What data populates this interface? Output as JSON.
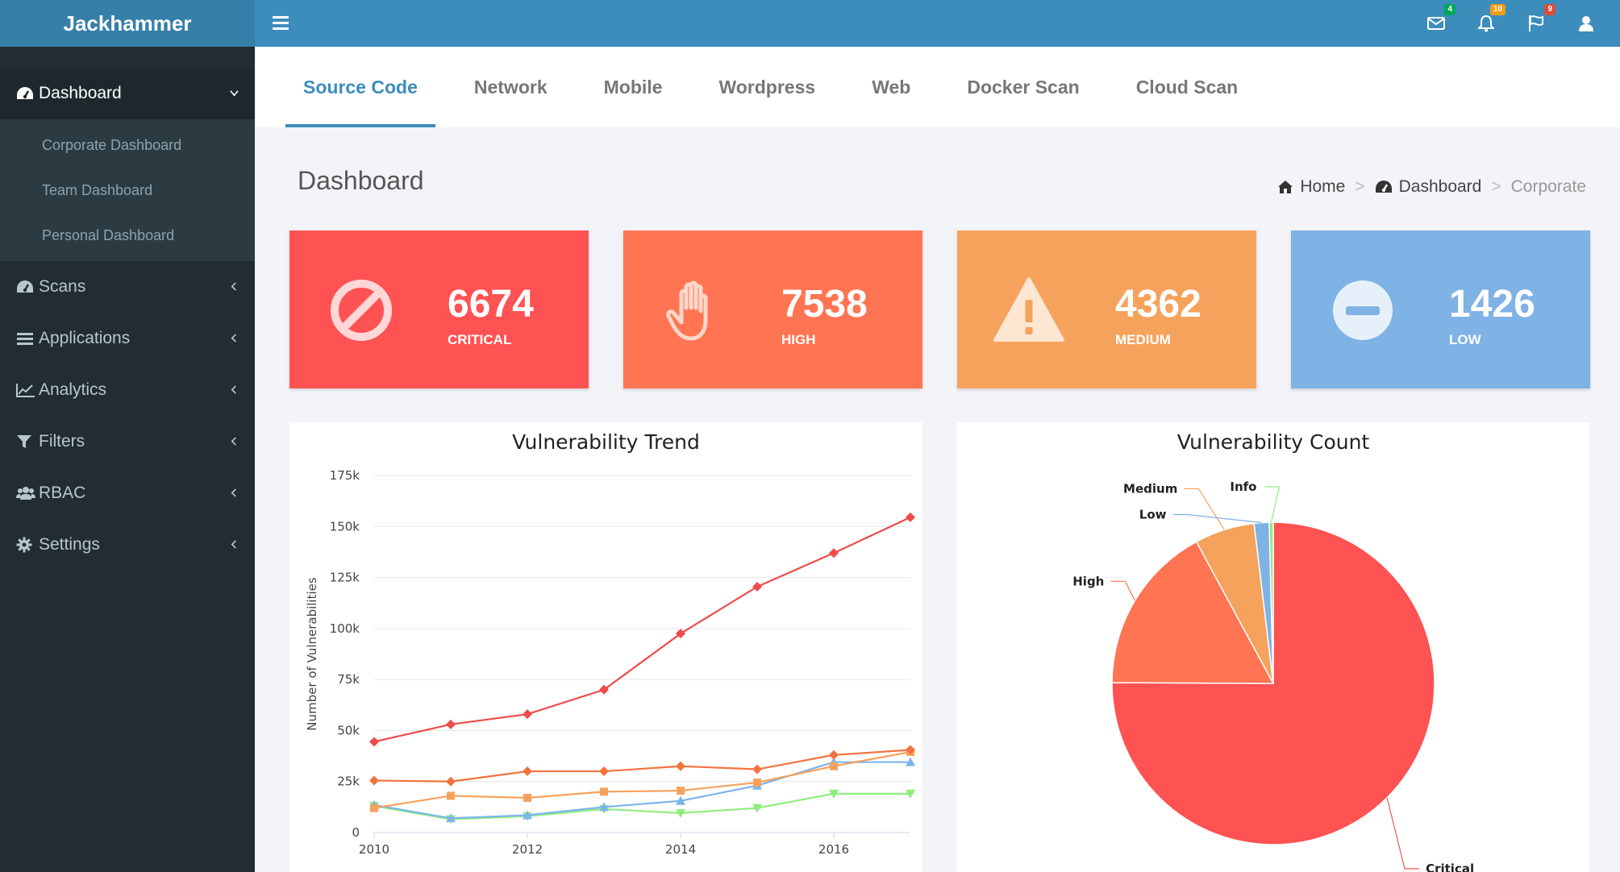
{
  "app": {
    "title": "Jackhammer"
  },
  "topbar": {
    "icons": [
      {
        "icon": "envelope-icon",
        "badge": "4",
        "badge_color": "#00a65a"
      },
      {
        "icon": "bell-icon",
        "badge": "10",
        "badge_color": "#f39c12"
      },
      {
        "icon": "flag-icon",
        "badge": "9",
        "badge_color": "#dd4b39"
      },
      {
        "icon": "user-icon"
      }
    ]
  },
  "sidebar": {
    "active": {
      "label": "Dashboard",
      "icon": "dashboard-icon"
    },
    "submenu": [
      "Corporate Dashboard",
      "Team Dashboard",
      "Personal Dashboard"
    ],
    "items": [
      {
        "label": "Scans",
        "icon": "dashboard-icon"
      },
      {
        "label": "Applications",
        "icon": "list-icon"
      },
      {
        "label": "Analytics",
        "icon": "line-chart-icon"
      },
      {
        "label": "Filters",
        "icon": "filter-icon"
      },
      {
        "label": "RBAC",
        "icon": "users-icon"
      },
      {
        "label": "Settings",
        "icon": "gear-icon"
      }
    ]
  },
  "tabs": [
    "Source Code",
    "Network",
    "Mobile",
    "Wordpress",
    "Web",
    "Docker Scan",
    "Cloud Scan"
  ],
  "header": {
    "title": "Dashboard"
  },
  "breadcrumb": {
    "home": "Home",
    "dashboard": "Dashboard",
    "current": "Corporate",
    "separator": ">"
  },
  "stats": [
    {
      "value": "6674",
      "label": "CRITICAL",
      "color": "#ff5252",
      "icon": "ban-icon"
    },
    {
      "value": "7538",
      "label": "HIGH",
      "color": "#ff7452",
      "icon": "hand-icon"
    },
    {
      "value": "4362",
      "label": "MEDIUM",
      "color": "#f5a25d",
      "icon": "warning-icon"
    },
    {
      "value": "1426",
      "label": "LOW",
      "color": "#7fb2e5",
      "icon": "minus-circle-icon"
    }
  ],
  "chart_data": [
    {
      "type": "line",
      "title": "Vulnerability Trend",
      "ylabel": "Number of Vulnerabilities",
      "xlabel": "",
      "x": [
        2010,
        2011,
        2012,
        2013,
        2014,
        2015,
        2016,
        2017
      ],
      "xticks": [
        "2010",
        "2012",
        "2014",
        "2016"
      ],
      "yticks": [
        "0",
        "25k",
        "50k",
        "75k",
        "100k",
        "125k",
        "150k",
        "175k"
      ],
      "ylim": [
        0,
        175000
      ],
      "xlim": [
        2010,
        2017
      ],
      "grid": true,
      "series": [
        {
          "color": "#ef4b4b",
          "marker": "diamond",
          "values": [
            44500,
            53000,
            58000,
            70000,
            97500,
            120500,
            137000,
            154500
          ]
        },
        {
          "color": "#f3733f",
          "marker": "diamond",
          "values": [
            25500,
            25000,
            30000,
            30000,
            32500,
            31000,
            38000,
            40500
          ]
        },
        {
          "color": "#f5a25d",
          "marker": "square",
          "values": [
            12000,
            18000,
            17000,
            20000,
            20500,
            24500,
            32500,
            39500
          ]
        },
        {
          "color": "#7cb5ec",
          "marker": "triangle",
          "values": [
            13500,
            7000,
            8500,
            12500,
            15500,
            23000,
            34500,
            34500
          ]
        },
        {
          "color": "#90ed7d",
          "marker": "triangle-down",
          "values": [
            13000,
            6500,
            8000,
            11500,
            9500,
            12000,
            19000,
            19000
          ]
        }
      ]
    },
    {
      "type": "pie",
      "title": "Vulnerability Count",
      "slices": [
        {
          "label": "Critical",
          "value": 75,
          "color": "#ff5252"
        },
        {
          "label": "High",
          "value": 17,
          "color": "#ff7452"
        },
        {
          "label": "Medium",
          "value": 6,
          "color": "#f5a25d"
        },
        {
          "label": "Low",
          "value": 1.5,
          "color": "#7fb2e5"
        },
        {
          "label": "Info",
          "value": 0.4,
          "color": "#90ed7d"
        }
      ]
    }
  ]
}
